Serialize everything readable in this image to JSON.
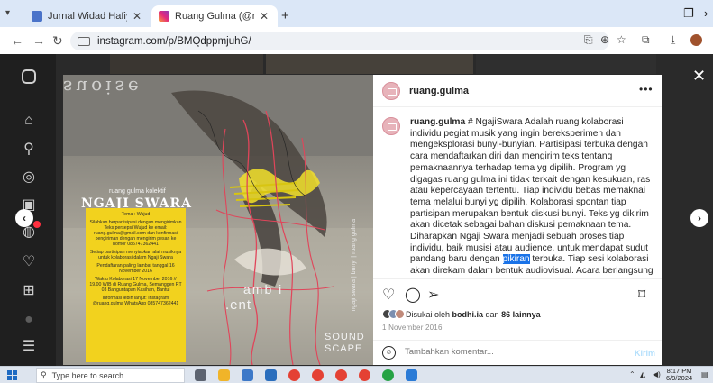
{
  "browser": {
    "tabs": [
      {
        "title": "Jurnal Widad Hafiyan Ustman.i",
        "active": false
      },
      {
        "title": "Ruang Gulma (@ruang.gulma)",
        "active": true
      }
    ],
    "url": "instagram.com/p/BMQdppmjuhG/"
  },
  "post": {
    "username": "ruang.gulma",
    "caption_user": "ruang.gulma",
    "caption_before": " # NgajiSwara Adalah ruang kolaborasi individu pegiat musik yang ingin bereksperimen dan mengeksplorasi bunyi-bunyian. Partisipasi terbuka dengan cara mendaftarkan diri dan mengirim teks tentang pemaknaannya terhadap tema yg dipilih. Program yg digagas ruang gulma ini tidak terkait dengan kesukuan, ras atau kepercayaan tertentu. Tiap individu bebas memaknai tema melalui bunyi yg dipilih. Kolaborasi spontan tiap partisipan merupakan bentuk diskusi bunyi. Teks yg dikirim akan dicetak sebagai bahan diskusi pemaknaan tema. Diharapkan Ngaji Swara menjadi sebuah proses tiap individu, baik musisi atau audience, untuk mendapat sudut pandang baru dengan ",
    "caption_highlight": "pikiran",
    "caption_after": " terbuka. Tiap sesi kolaborasi akan direkam dalam bentuk audiovisual. Acara berlangsung tiap kamis minggu kedua. Persiapan dan jamming bebas dimulai sejak jam 3 sore, sesi kolaborasi partisipan terdaftar akan berlangsung dan jam 7 sampai jam 9 malam. Setelah itu ngobrol santai seputar proses yg telah dilalui selama sesi kolaborasi.",
    "liked_prefix": "Disukai oleh ",
    "liked_user": "bodhi.ia",
    "liked_mid": " dan ",
    "liked_count": "86 lainnya",
    "date": "1 November 2016",
    "comment_placeholder": "Tambahkan komentar...",
    "post_button": "Kirim"
  },
  "poster": {
    "top_text": "suoise",
    "subtitle": "ruang gulma kolektif",
    "headline": "NGAJI SWARA",
    "side_text": "ngaji swara | bunyi | ruang gulma",
    "ambient": "amb",
    "ambient2": "i",
    "ent": ".ent",
    "sound1": "SOUND",
    "sound2": "SCAPE",
    "info_lines": [
      "Tema : Wujud",
      "Silahkan berpartisipasi dengan mengirimkan Teks persepsi Wujud ke email: ruang.gulma@gmail.com dan konfirmasi pengiriman dengan mengirim pesan ke nomor 085747362441",
      "Setiap partisipan menyiapkan alat musiknya untuk kolaborasi dalam Ngaji Swara",
      "Pendaftaran paling lambat tanggal 16 November 2016",
      "Waktu Kolaborasi 17 November 2016 // 19.00 WIB di Ruang Gulma, Semanggen RT 03 Banguntapan Kasihan, Bantul",
      "Informasi lebih lanjut: Instagram @ruang.gulma WhatsApp 085747362441"
    ]
  },
  "taskbar": {
    "search_placeholder": "Type here to search",
    "time": "8:17 PM",
    "date": "6/9/2024"
  },
  "colors": {
    "tabbar": "#dbe7f7",
    "ig_dark": "#1f1f1f",
    "poster_yellow": "#f2d21e",
    "highlight": "#1a73e8"
  }
}
